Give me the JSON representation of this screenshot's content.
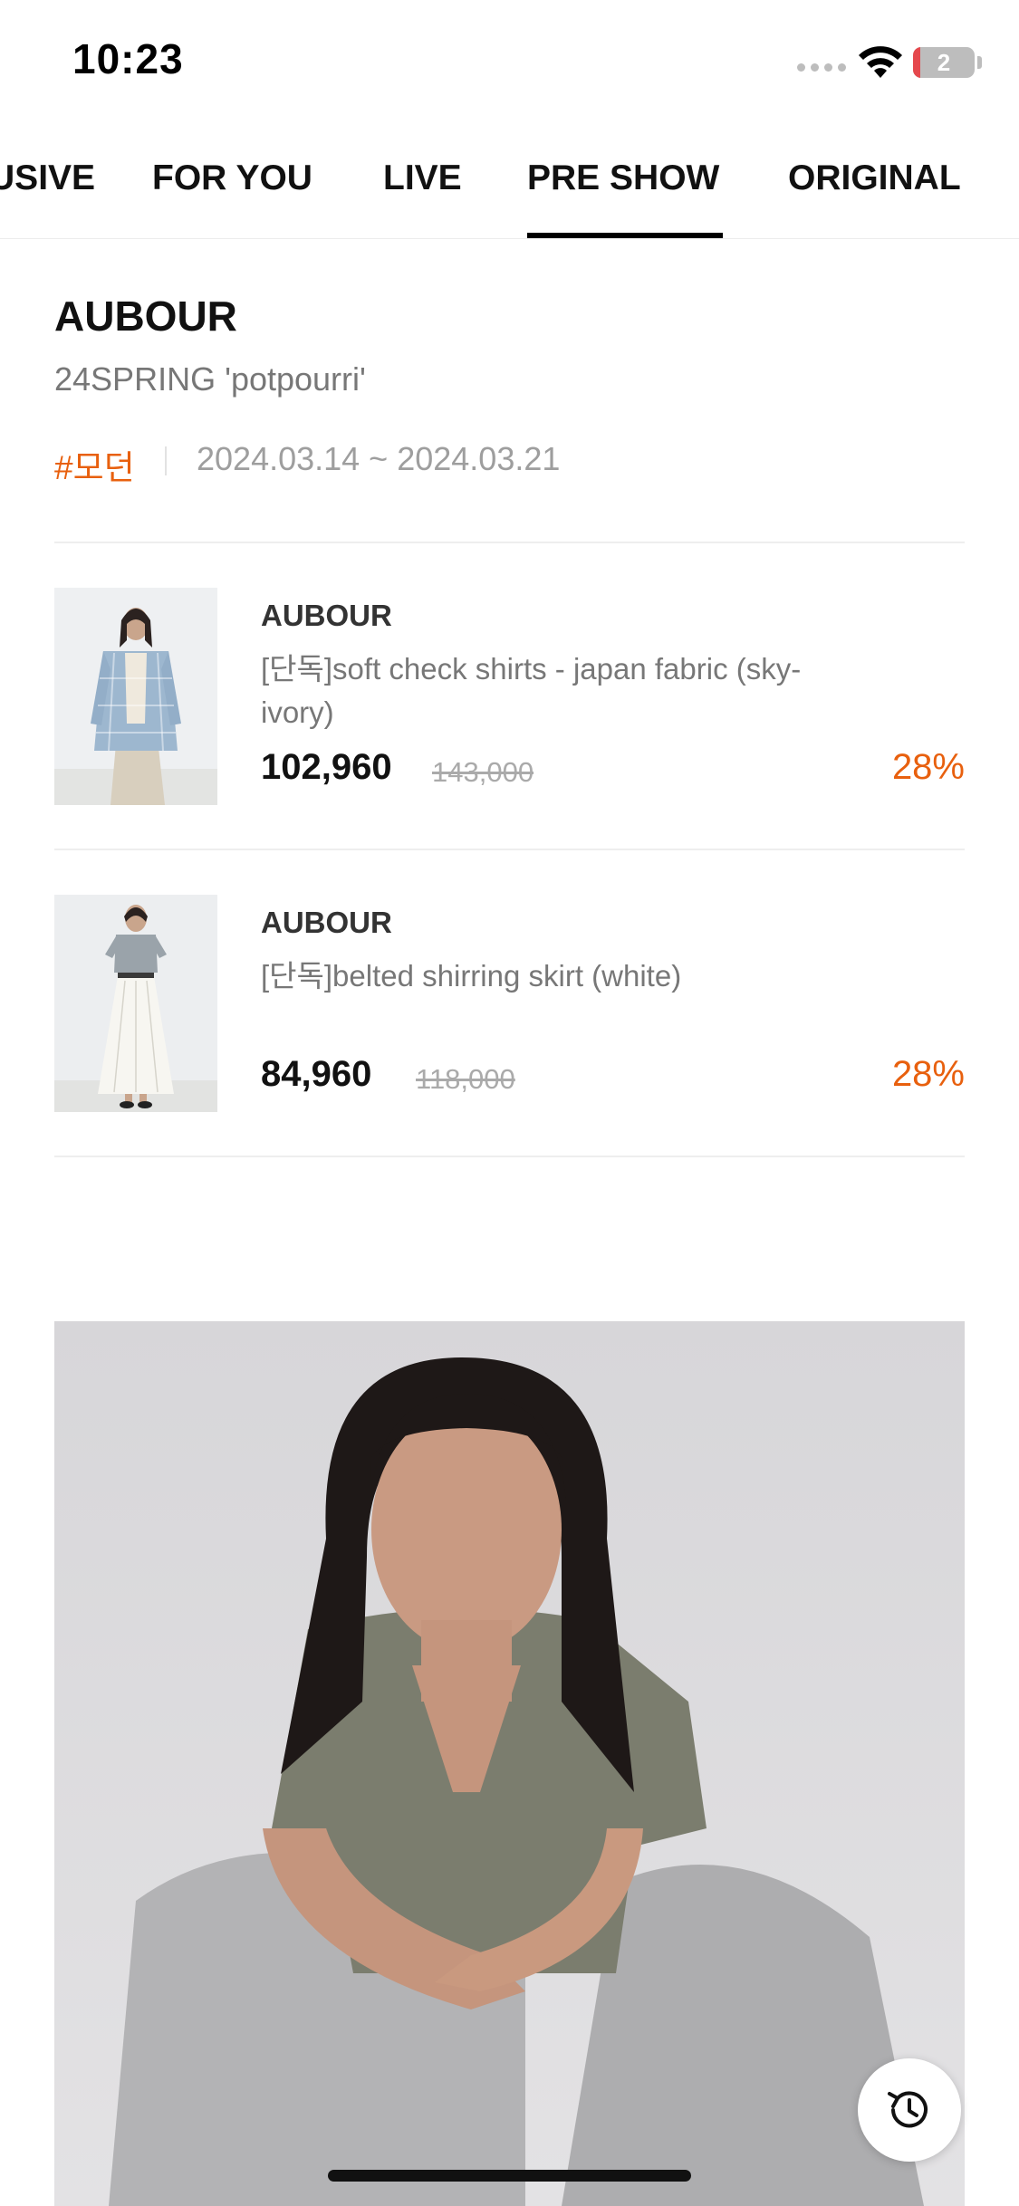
{
  "status_bar": {
    "time": "10:23",
    "battery_label": "2",
    "battery_level": 0.12,
    "battery_color": "#e5484d",
    "icons": [
      "signal-dots-icon",
      "wifi-icon",
      "battery-icon"
    ]
  },
  "tabs": [
    {
      "label": "EXCLUSIVE",
      "active": false
    },
    {
      "label": "FOR YOU",
      "active": false
    },
    {
      "label": "LIVE",
      "active": false
    },
    {
      "label": "PRE SHOW",
      "active": true
    },
    {
      "label": "ORIGINAL",
      "active": false
    }
  ],
  "show": {
    "brand": "AUBOUR",
    "collection": "24SPRING 'potpourri'",
    "hashtag": "#모던",
    "date_range": "2024.03.14 ~ 2024.03.21"
  },
  "products": [
    {
      "brand": "AUBOUR",
      "name": "[단독]soft check shirts - japan fabric (sky-ivory)",
      "price": "102,960",
      "original_price": "143,000",
      "discount": "28%"
    },
    {
      "brand": "AUBOUR",
      "name": "[단독]belted shirring skirt (white)",
      "price": "84,960",
      "original_price": "118,000",
      "discount": "28%"
    }
  ],
  "floating_button": {
    "icon": "history-icon"
  },
  "colors": {
    "accent": "#e8600e",
    "text": "#111111",
    "muted": "#777777",
    "divider": "#eeeeee"
  }
}
